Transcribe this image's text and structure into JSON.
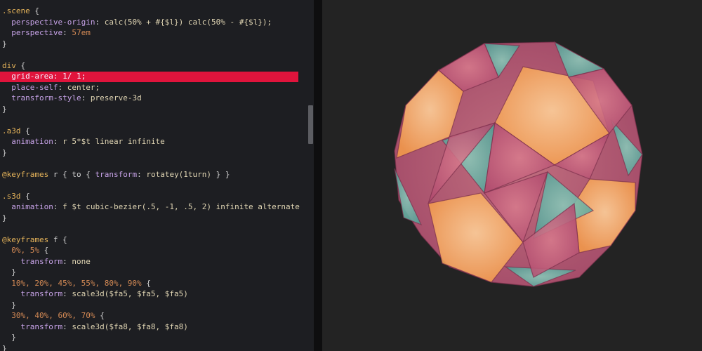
{
  "editor": {
    "lines": [
      {
        "tokens": [
          {
            "t": ".scene",
            "c": "sel"
          },
          {
            "t": " {",
            "c": "txt"
          }
        ]
      },
      {
        "tokens": [
          {
            "t": "  perspective-origin",
            "c": "prop"
          },
          {
            "t": ": ",
            "c": "txt"
          },
          {
            "t": "calc(50% + #{$l}) calc(50% - #{$l});",
            "c": "val"
          }
        ]
      },
      {
        "tokens": [
          {
            "t": "  perspective",
            "c": "prop"
          },
          {
            "t": ": ",
            "c": "txt"
          },
          {
            "t": "57em",
            "c": "num"
          }
        ]
      },
      {
        "tokens": [
          {
            "t": "}",
            "c": "txt"
          }
        ]
      },
      {
        "tokens": []
      },
      {
        "tokens": [
          {
            "t": "div",
            "c": "sel"
          },
          {
            "t": " {",
            "c": "txt"
          }
        ]
      },
      {
        "hl": true,
        "tokens": [
          {
            "t": "  grid-area",
            "c": "prop"
          },
          {
            "t": ": ",
            "c": "txt"
          },
          {
            "t": "1/ 1;",
            "c": "val"
          }
        ]
      },
      {
        "tokens": [
          {
            "t": "  place-self",
            "c": "prop"
          },
          {
            "t": ": ",
            "c": "txt"
          },
          {
            "t": "center;",
            "c": "val"
          }
        ]
      },
      {
        "tokens": [
          {
            "t": "  transform-style",
            "c": "prop"
          },
          {
            "t": ": ",
            "c": "txt"
          },
          {
            "t": "preserve-3d",
            "c": "val"
          }
        ]
      },
      {
        "tokens": [
          {
            "t": "}",
            "c": "txt"
          }
        ]
      },
      {
        "tokens": []
      },
      {
        "tokens": [
          {
            "t": ".a3d",
            "c": "sel"
          },
          {
            "t": " {",
            "c": "txt"
          }
        ]
      },
      {
        "tokens": [
          {
            "t": "  animation",
            "c": "prop"
          },
          {
            "t": ": ",
            "c": "txt"
          },
          {
            "t": "r 5*$t linear infinite",
            "c": "val"
          }
        ]
      },
      {
        "tokens": [
          {
            "t": "}",
            "c": "txt"
          }
        ]
      },
      {
        "tokens": []
      },
      {
        "tokens": [
          {
            "t": "@keyframes",
            "c": "kw"
          },
          {
            "t": " r { to { ",
            "c": "txt"
          },
          {
            "t": "transform",
            "c": "prop"
          },
          {
            "t": ": ",
            "c": "txt"
          },
          {
            "t": "rotatey(1turn)",
            "c": "val"
          },
          {
            "t": " } }",
            "c": "txt"
          }
        ]
      },
      {
        "tokens": []
      },
      {
        "tokens": [
          {
            "t": ".s3d",
            "c": "sel"
          },
          {
            "t": " {",
            "c": "txt"
          }
        ]
      },
      {
        "tokens": [
          {
            "t": "  animation",
            "c": "prop"
          },
          {
            "t": ": ",
            "c": "txt"
          },
          {
            "t": "f $t cubic-bezier(.5, -1, .5, 2) infinite alternate",
            "c": "val"
          }
        ]
      },
      {
        "tokens": [
          {
            "t": "}",
            "c": "txt"
          }
        ]
      },
      {
        "tokens": []
      },
      {
        "tokens": [
          {
            "t": "@keyframes",
            "c": "kw"
          },
          {
            "t": " f {",
            "c": "txt"
          }
        ]
      },
      {
        "tokens": [
          {
            "t": "  0%, 5%",
            "c": "num"
          },
          {
            "t": " {",
            "c": "txt"
          }
        ]
      },
      {
        "tokens": [
          {
            "t": "    transform",
            "c": "prop"
          },
          {
            "t": ": ",
            "c": "txt"
          },
          {
            "t": "none",
            "c": "val"
          }
        ]
      },
      {
        "tokens": [
          {
            "t": "  }",
            "c": "txt"
          }
        ]
      },
      {
        "tokens": [
          {
            "t": "  10%, 20%, 45%, 55%, 80%, 90%",
            "c": "num"
          },
          {
            "t": " {",
            "c": "txt"
          }
        ]
      },
      {
        "tokens": [
          {
            "t": "    transform",
            "c": "prop"
          },
          {
            "t": ": ",
            "c": "txt"
          },
          {
            "t": "scale3d($fa5, $fa5, $fa5)",
            "c": "val"
          }
        ]
      },
      {
        "tokens": [
          {
            "t": "  }",
            "c": "txt"
          }
        ]
      },
      {
        "tokens": [
          {
            "t": "  30%, 40%, 60%, 70%",
            "c": "num"
          },
          {
            "t": " {",
            "c": "txt"
          }
        ]
      },
      {
        "tokens": [
          {
            "t": "    transform",
            "c": "prop"
          },
          {
            "t": ": ",
            "c": "txt"
          },
          {
            "t": "scale3d($fa8, $fa8, $fa8)",
            "c": "val"
          }
        ]
      },
      {
        "tokens": [
          {
            "t": "  }",
            "c": "txt"
          }
        ]
      },
      {
        "tokens": [
          {
            "t": "}",
            "c": "txt"
          }
        ]
      }
    ]
  },
  "preview": {
    "colors": {
      "orange": "#f39a4a",
      "magenta": "#b04a6e",
      "teal": "#4f9e94",
      "edge": "#7a2f4c"
    }
  }
}
